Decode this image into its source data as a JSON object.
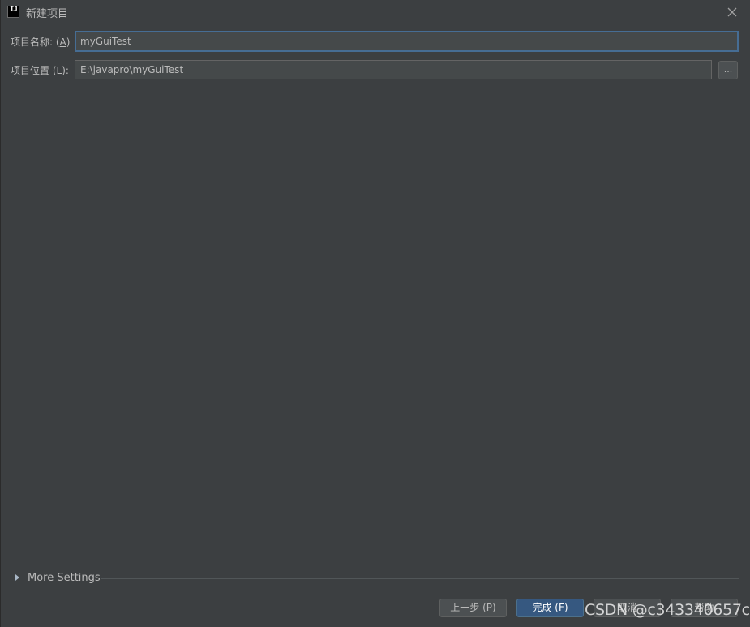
{
  "window": {
    "title": "新建项目",
    "close_icon": "close-icon"
  },
  "form": {
    "name_label": "项目名称: (",
    "name_mnemonic": "A",
    "name_label_end": ")",
    "name_value": "myGuiTest",
    "location_label": "项目位置 (",
    "location_mnemonic": "L",
    "location_label_end": "):",
    "location_value": "E:\\javapro\\myGuiTest",
    "browse_label": "..."
  },
  "more_settings": {
    "label": "More Settings"
  },
  "buttons": {
    "previous": "上一步 (P)",
    "finish": "完成 (F)",
    "cancel": "取消",
    "help": "帮助"
  },
  "watermark": "CSDN @c343340657c",
  "colors": {
    "background": "#3c3f41",
    "input_bg": "#45494a",
    "focus_border": "#466d94",
    "primary_button": "#365880"
  }
}
